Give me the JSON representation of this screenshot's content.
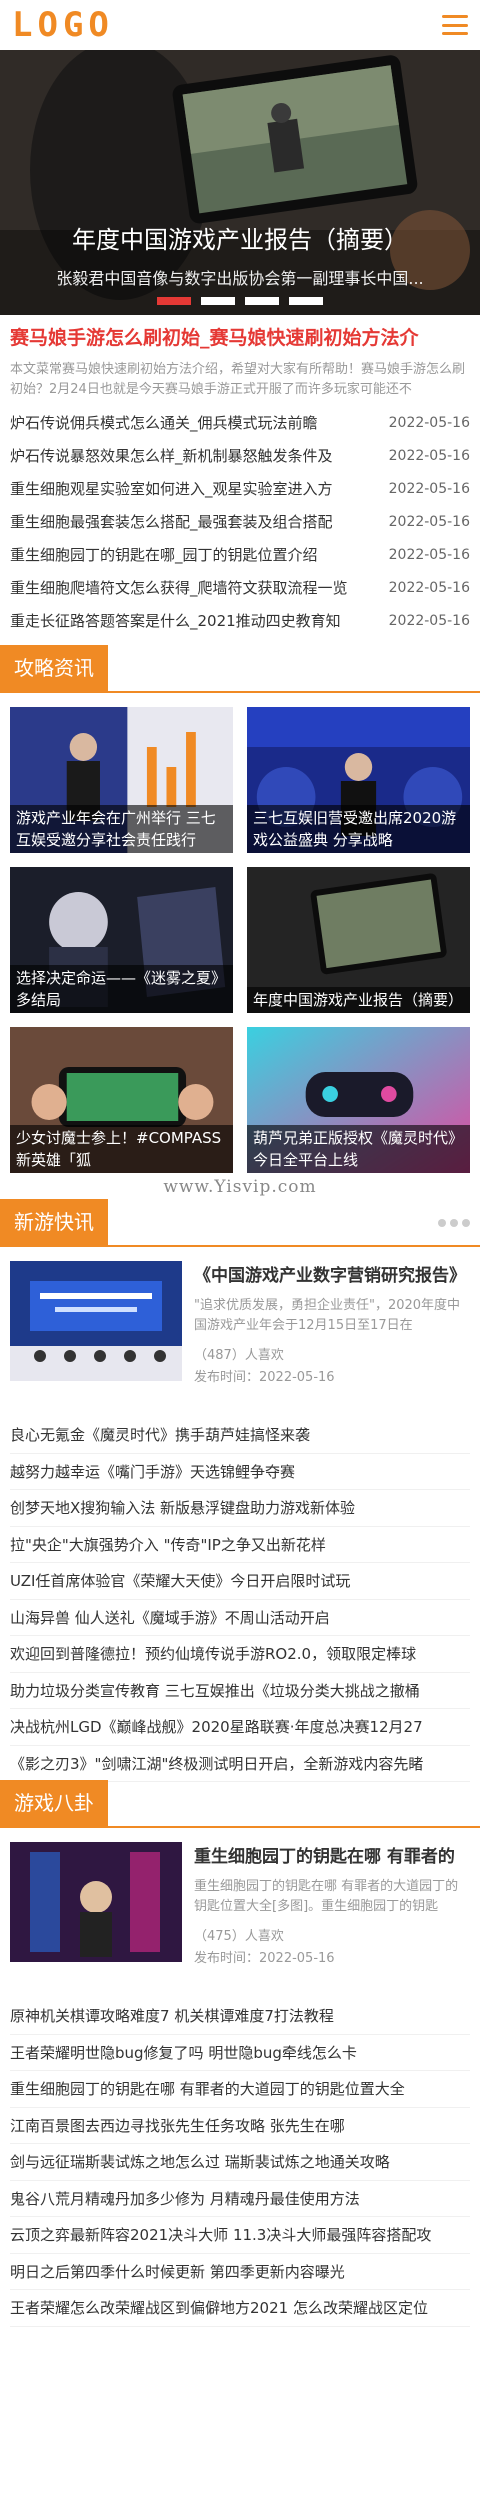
{
  "header": {
    "logo": "LOGO",
    "menu_icon": "menu-icon"
  },
  "hero": {
    "title": "年度中国游戏产业报告（摘要）",
    "subtitle": "张毅君中国音像与数字出版协会第一副理事长中国...",
    "dots_count": 4,
    "active_dot": 0
  },
  "headline": {
    "title": "赛马娘手游怎么刷初始_赛马娘快速刷初始方法介",
    "summary": "本文菜常赛马娘快速刷初始方法介绍，希望对大家有所帮助！赛马娘手游怎么刷初始？2月24日也就是今天赛马娘手游正式开服了而许多玩家可能还不"
  },
  "latest_news": [
    {
      "title": "炉石传说佣兵模式怎么通关_佣兵模式玩法前瞻",
      "date": "2022-05-16"
    },
    {
      "title": "炉石传说暴怒效果怎么样_新机制暴怒触发条件及",
      "date": "2022-05-16"
    },
    {
      "title": "重生细胞观星实验室如何进入_观星实验室进入方",
      "date": "2022-05-16"
    },
    {
      "title": "重生细胞最强套装怎么搭配_最强套装及组合搭配",
      "date": "2022-05-16"
    },
    {
      "title": "重生细胞园丁的钥匙在哪_园丁的钥匙位置介绍",
      "date": "2022-05-16"
    },
    {
      "title": "重生细胞爬墙符文怎么获得_爬墙符文获取流程一览",
      "date": "2022-05-16"
    },
    {
      "title": "重走长征路答题答案是什么_2021推动四史教育知",
      "date": "2022-05-16"
    }
  ],
  "section_strategy": {
    "title": "攻略资讯",
    "cards": [
      {
        "caption": "游戏产业年会在广州举行 三七互娱受邀分享社会责任践行"
      },
      {
        "caption": "三七互娱旧营受邀出席2020游戏公益盛典 分享战略"
      },
      {
        "caption": "选择决定命运——《迷雾之夏》多结局"
      },
      {
        "caption": "年度中国游戏产业报告（摘要）"
      },
      {
        "caption": "少女讨魔士参上！#COMPASS新英雄「狐"
      },
      {
        "caption": "葫芦兄弟正版授权《魔灵时代》今日全平台上线"
      }
    ],
    "watermark": "www.Yisvip.com"
  },
  "section_new_games": {
    "title": "新游快讯",
    "feature": {
      "title": "《中国游戏产业数字营销研究报告》",
      "desc": "\"追求优质发展，勇担企业责任\"，2020年度中国游戏产业年会于12月15日至17日在",
      "views": "（487）人喜欢",
      "publish": "发布时间：2022-05-16"
    },
    "list": [
      "良心无氪金《魔灵时代》携手葫芦娃搞怪来袭",
      "越努力越幸运《嘴门手游》天选锦鲤争夺赛",
      "创梦天地X搜狗输入法 新版悬浮键盘助力游戏新体验",
      "拉\"央企\"大旗强势介入 \"传奇\"IP之争又出新花样",
      "UZI任首席体验官《荣耀大天使》今日开启限时试玩",
      "山海异兽 仙人送礼《魔域手游》不周山活动开启",
      "欢迎回到普隆德拉！预约仙境传说手游RO2.0，领取限定棒球",
      "助力垃圾分类宣传教育 三七互娱推出《垃圾分类大挑战之撤桶",
      "决战杭州LGD《巅峰战舰》2020星路联赛·年度总决赛12月27",
      "《影之刃3》\"剑啸江湖\"终极测试明日开启，全新游戏内容先睹"
    ]
  },
  "section_gossip": {
    "title": "游戏八卦",
    "feature": {
      "title": "重生细胞园丁的钥匙在哪 有罪者的",
      "desc": "重生细胞园丁的钥匙在哪 有罪者的大道园丁的钥匙位置大全[多图]。重生细胞园丁的钥匙",
      "views": "（475）人喜欢",
      "publish": "发布时间：2022-05-16"
    },
    "list": [
      "原神机关棋谭攻略难度7 机关棋谭难度7打法教程",
      "王者荣耀明世隐bug修复了吗 明世隐bug牵线怎么卡",
      "重生细胞园丁的钥匙在哪 有罪者的大道园丁的钥匙位置大全",
      "江南百景图去西边寻找张先生任务攻略 张先生在哪",
      "剑与远征瑞斯裴试炼之地怎么过 瑞斯裴试炼之地通关攻略",
      "鬼谷八荒月精魂丹加多少修为 月精魂丹最佳使用方法",
      "云顶之弈最新阵容2021决斗大师 11.3决斗大师最强阵容搭配攻",
      "明日之后第四季什么时候更新 第四季更新内容曝光",
      "王者荣耀怎么改荣耀战区到偏僻地方2021 怎么改荣耀战区定位"
    ]
  }
}
